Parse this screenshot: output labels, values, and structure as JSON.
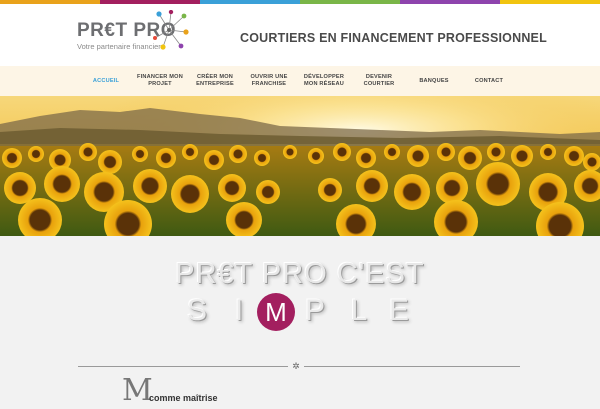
{
  "brand": {
    "logo_text": "PR€T PRO",
    "logo_tagline": "Votre partenaire financier",
    "tagline": "COURTIERS EN FINANCEMENT PROFESSIONNEL",
    "accent_colors": [
      "#e9a21b",
      "#a31f5f",
      "#3aa0d8",
      "#7ab648",
      "#8e44ad",
      "#f1c40f"
    ]
  },
  "nav": {
    "items": [
      {
        "label": "ACCUEIL",
        "active": true
      },
      {
        "label": "FINANCER MON PROJET",
        "line1": "FINANCER MON",
        "line2": "PROJET"
      },
      {
        "label": "CRÉER MON ENTREPRISE",
        "line1": "CRÉER MON",
        "line2": "ENTREPRISE"
      },
      {
        "label": "OUVRIR UNE FRANCHISE",
        "line1": "OUVRIR UNE",
        "line2": "FRANCHISE"
      },
      {
        "label": "DÉVELOPPER MON RÉSEAU",
        "line1": "DÉVELOPPER",
        "line2": "MON RÉSEAU"
      },
      {
        "label": "DEVENIR COURTIER",
        "line1": "DEVENIR",
        "line2": "COURTIER"
      },
      {
        "label": "BANQUES"
      },
      {
        "label": "CONTACT"
      }
    ]
  },
  "hero": {
    "image_subject": "sunflower-field-at-sunset"
  },
  "simple": {
    "headline1": "PR€T PRO C'EST",
    "letters": [
      "S",
      "I",
      "M",
      "P",
      "L",
      "E"
    ],
    "highlight_color": "#a31f5f"
  },
  "section": {
    "big_letter": "M",
    "caption": "comme maîtrise"
  }
}
